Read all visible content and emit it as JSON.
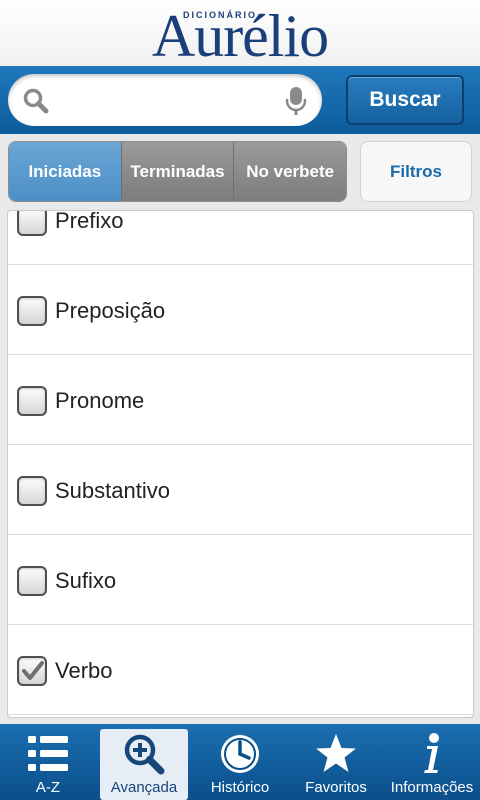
{
  "header": {
    "logo_small": "DICIONÁRIO",
    "logo_big": "Aurélio"
  },
  "search": {
    "value": "",
    "placeholder": "",
    "button_label": "Buscar"
  },
  "segments": {
    "items": [
      {
        "label": "Iniciadas",
        "active": true
      },
      {
        "label": "Terminadas",
        "active": false
      },
      {
        "label": "No verbete",
        "active": false
      }
    ],
    "filters_label": "Filtros"
  },
  "list": {
    "items": [
      {
        "label": "Prefixo",
        "checked": false
      },
      {
        "label": "Preposição",
        "checked": false
      },
      {
        "label": "Pronome",
        "checked": false
      },
      {
        "label": "Substantivo",
        "checked": false
      },
      {
        "label": "Sufixo",
        "checked": false
      },
      {
        "label": "Verbo",
        "checked": true
      }
    ]
  },
  "tabs": [
    {
      "label": "A-Z",
      "icon": "list-icon",
      "active": false
    },
    {
      "label": "Avançada",
      "icon": "zoom-in-icon",
      "active": true
    },
    {
      "label": "Histórico",
      "icon": "clock-icon",
      "active": false
    },
    {
      "label": "Favoritos",
      "icon": "star-icon",
      "active": false
    },
    {
      "label": "Informações",
      "icon": "info-icon",
      "active": false
    }
  ],
  "colors": {
    "brand_blue": "#1b3f7a",
    "bar_blue": "#1566a8",
    "active_segment": "#5b9bcf",
    "inactive_segment": "#8a8a8a"
  }
}
